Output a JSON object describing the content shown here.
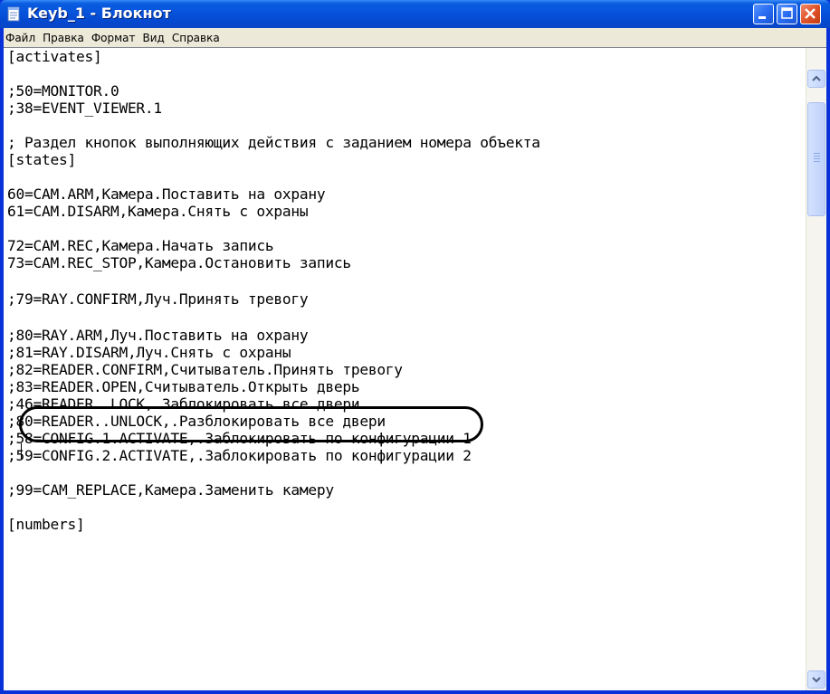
{
  "window": {
    "title": "Keyb_1 - Блокнот",
    "icon": "notepad-icon",
    "controls": [
      "minimize-icon",
      "maximize-icon",
      "close-icon"
    ],
    "accent_color": "#0a5de0"
  },
  "menu": {
    "items": [
      "Файл",
      "Правка",
      "Формат",
      "Вид",
      "Справка"
    ]
  },
  "editor": {
    "lines": [
      "[activates]",
      "",
      ";50=MONITOR.0",
      ";38=EVENT_VIEWER.1",
      "",
      "; Раздел кнопок выполняющих действия с заданием номера объекта",
      "[states]",
      "",
      "60=CAM.ARM,Камера.Поставить на охрану",
      "61=CAM.DISARM,Камера.Снять с охраны",
      "",
      "72=CAM.REC,Камера.Начать запись",
      "73=CAM.REC_STOP,Камера.Остановить запись",
      "",
      ";79=RAY.CONFIRM,Луч.Принять тревогу",
      "",
      ";80=RAY.ARM,Луч.Поставить на охрану",
      ";81=RAY.DISARM,Луч.Снять с охраны",
      ";82=READER.CONFIRM,Считыватель.Принять тревогу",
      ";83=READER.OPEN,Считыватель.Открыть дверь",
      ";46=READER..LOCK,.Заблокировать все двери",
      ";80=READER..UNLOCK,.Разблокировать все двери",
      ";58=CONFIG.1.ACTIVATE,.Заблокировать по конфигурации 1",
      ";59=CONFIG.2.ACTIVATE,.Заблокировать по конфигурации 2",
      "",
      ";99=CAM_REPLACE,Камера.Заменить камеру",
      "",
      "[numbers]"
    ],
    "highlighted_line_index": 14
  },
  "scrollbar": {
    "up_icon": "scroll-up-arrow-icon",
    "down_icon": "scroll-down-arrow-icon"
  }
}
